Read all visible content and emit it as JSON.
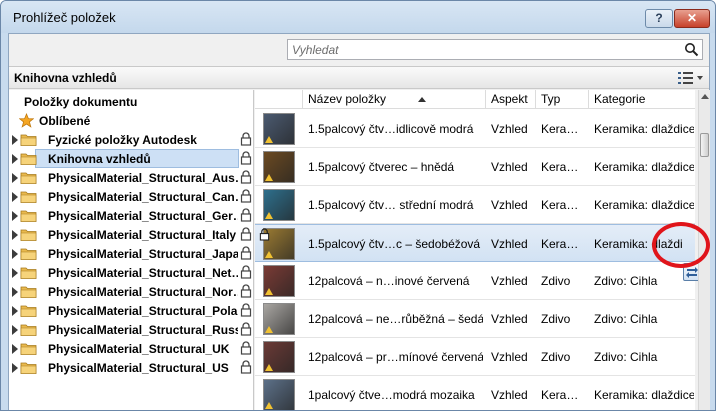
{
  "window": {
    "title": "Prohlížeč položek",
    "help_label": "?",
    "close_label": "✕"
  },
  "search": {
    "placeholder": "Vyhledat",
    "icon": "search-icon"
  },
  "library": {
    "title": "Knihovna vzhledů",
    "view_icon": "list-view-icon"
  },
  "tree": {
    "header": "Položky dokumentu",
    "favorites": "Oblíbené",
    "items": [
      {
        "label": "Fyzické položky Autodesk",
        "locked": true,
        "selected": false
      },
      {
        "label": "Knihovna vzhledů",
        "locked": true,
        "selected": true
      },
      {
        "label": "PhysicalMaterial_Structural_Aus…",
        "locked": true,
        "selected": false
      },
      {
        "label": "PhysicalMaterial_Structural_Can…",
        "locked": true,
        "selected": false
      },
      {
        "label": "PhysicalMaterial_Structural_Ger…",
        "locked": true,
        "selected": false
      },
      {
        "label": "PhysicalMaterial_Structural_Italy",
        "locked": true,
        "selected": false
      },
      {
        "label": "PhysicalMaterial_Structural_Japan",
        "locked": true,
        "selected": false
      },
      {
        "label": "PhysicalMaterial_Structural_Net…",
        "locked": true,
        "selected": false
      },
      {
        "label": "PhysicalMaterial_Structural_Nor…",
        "locked": true,
        "selected": false
      },
      {
        "label": "PhysicalMaterial_Structural_Pola…",
        "locked": true,
        "selected": false
      },
      {
        "label": "PhysicalMaterial_Structural_Russia",
        "locked": true,
        "selected": false
      },
      {
        "label": "PhysicalMaterial_Structural_UK",
        "locked": true,
        "selected": false
      },
      {
        "label": "PhysicalMaterial_Structural_US",
        "locked": true,
        "selected": false
      }
    ]
  },
  "grid": {
    "columns": [
      "Název položky",
      "Aspekt",
      "Typ",
      "Kategorie"
    ],
    "rows": [
      {
        "name": "1.5palcový čtv…idlicově modrá",
        "aspect": "Vzhled",
        "type": "Kera…",
        "category": "Keramika: dlaždice",
        "color": "#4b5a70"
      },
      {
        "name": "1.5palcový čtverec – hnědá",
        "aspect": "Vzhled",
        "type": "Kera…",
        "category": "Keramika: dlaždice",
        "color": "#6b4a22"
      },
      {
        "name": "1.5palcový čtv… střední modrá",
        "aspect": "Vzhled",
        "type": "Kera…",
        "category": "Keramika: dlaždice",
        "color": "#2e6f8c"
      },
      {
        "name": "1.5palcový čtv…c – šedobéžová",
        "aspect": "Vzhled",
        "type": "Kera…",
        "category": "Keramika: dlaždice",
        "color": "#9a7a32"
      },
      {
        "name": "12palcová – n…inové červená",
        "aspect": "Vzhled",
        "type": "Zdivo",
        "category": "Zdivo: Cihla",
        "color": "#7a3b35"
      },
      {
        "name": "12palcová – ne…růběžná – šedá",
        "aspect": "Vzhled",
        "type": "Zdivo",
        "category": "Zdivo: Cihla",
        "color": "#a9a6a2"
      },
      {
        "name": "12palcová – pr…mínové červená",
        "aspect": "Vzhled",
        "type": "Zdivo",
        "category": "Zdivo: Cihla",
        "color": "#6a3a36"
      },
      {
        "name": "1palcový čtve…modrá mozaika",
        "aspect": "Vzhled",
        "type": "Kera…",
        "category": "Keramika: dlaždice",
        "color": "#5c7088"
      }
    ]
  },
  "colors": {
    "accent": "#cde0f5",
    "annotation_circle": "#e0151b"
  }
}
